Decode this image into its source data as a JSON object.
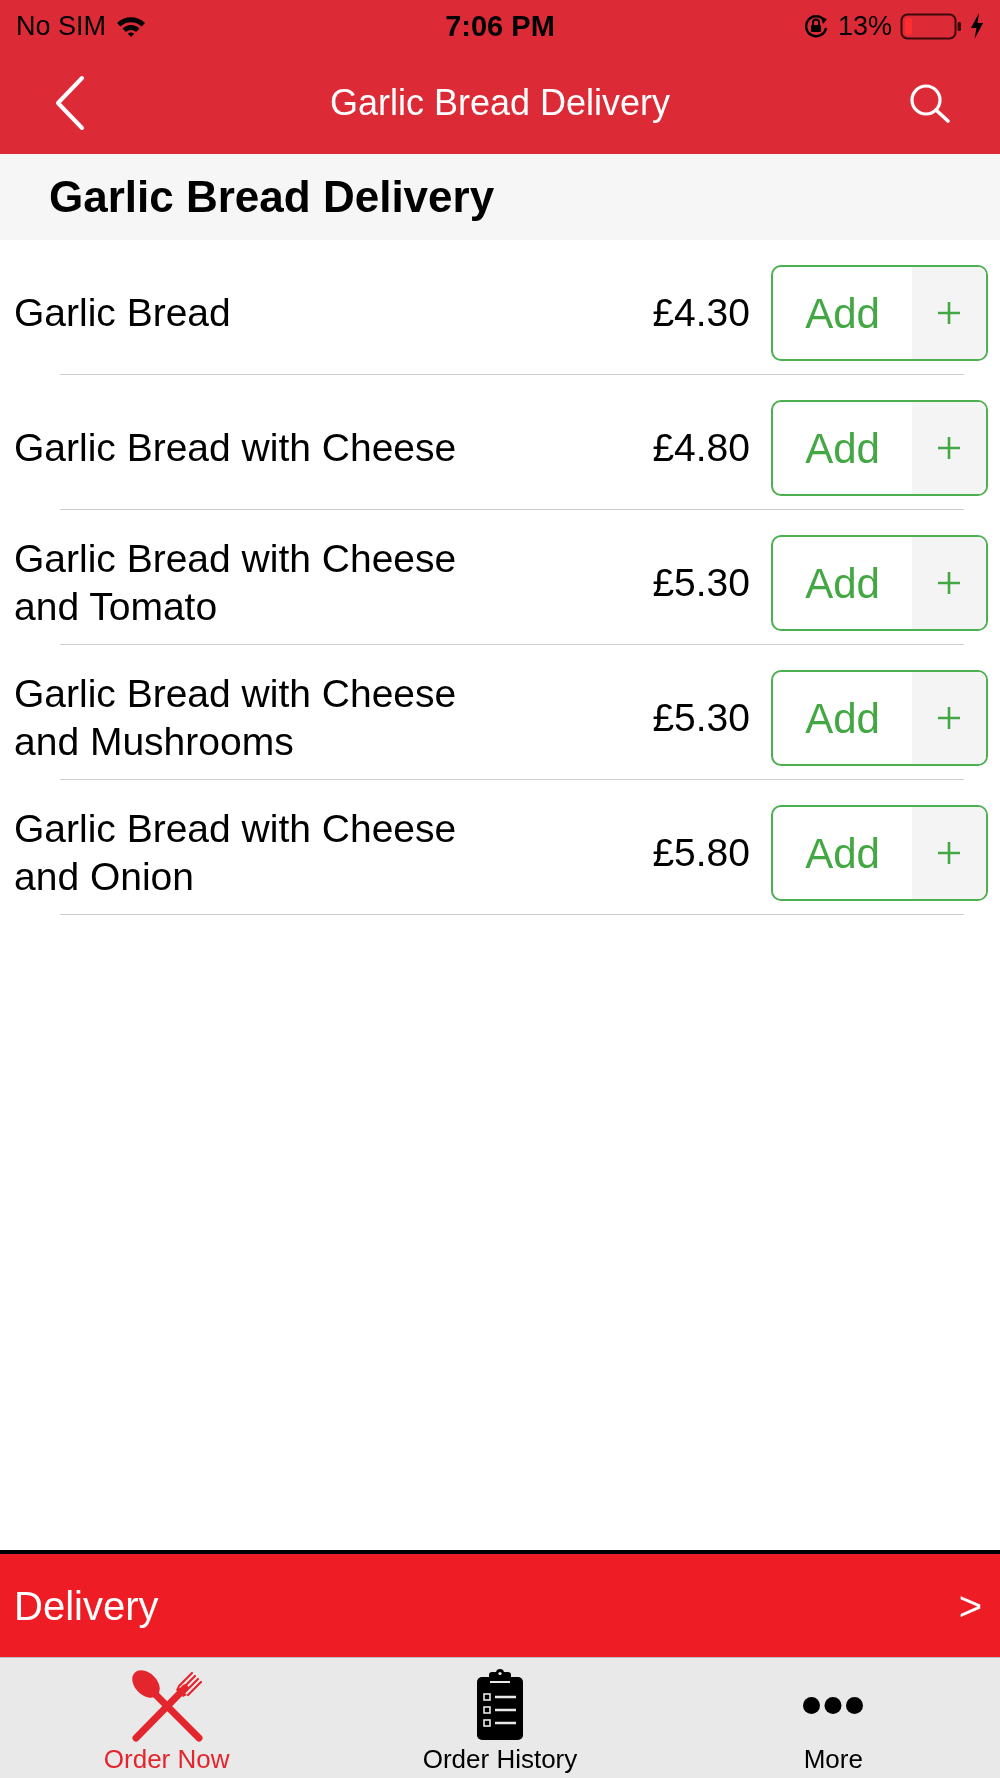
{
  "status_bar": {
    "carrier": "No SIM",
    "time": "7:06 PM",
    "battery_percent": "13%"
  },
  "nav_bar": {
    "title": "Garlic Bread Delivery"
  },
  "section": {
    "title": "Garlic Bread Delivery"
  },
  "items": [
    {
      "name": "Garlic Bread",
      "price": "£4.30",
      "button": "Add"
    },
    {
      "name": "Garlic Bread with Cheese",
      "price": "£4.80",
      "button": "Add"
    },
    {
      "name": "Garlic Bread with Cheese and Tomato",
      "price": "£5.30",
      "button": "Add"
    },
    {
      "name": "Garlic Bread with Cheese and Mushrooms",
      "price": "£5.30",
      "button": "Add"
    },
    {
      "name": "Garlic Bread with Cheese and Onion",
      "price": "£5.80",
      "button": "Add"
    }
  ],
  "delivery_bar": {
    "label": "Delivery",
    "arrow": ">"
  },
  "tab_bar": [
    {
      "label": "Order Now",
      "selected": true
    },
    {
      "label": "Order History",
      "selected": false
    },
    {
      "label": "More",
      "selected": false
    }
  ]
}
